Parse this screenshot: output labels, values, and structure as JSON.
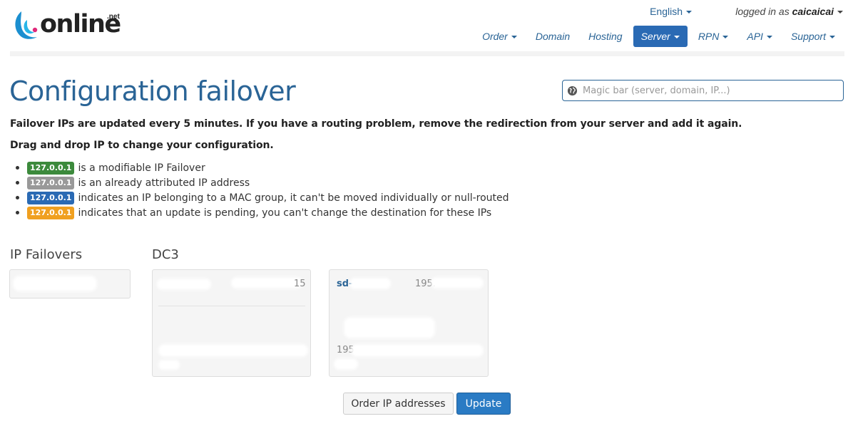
{
  "header": {
    "logo_text": "online",
    "logo_suffix": ".net",
    "language": "English",
    "logged_prefix": "logged in as",
    "username": "caicaicai",
    "nav": [
      {
        "label": "Order",
        "dropdown": true,
        "active": false
      },
      {
        "label": "Domain",
        "dropdown": false,
        "active": false
      },
      {
        "label": "Hosting",
        "dropdown": false,
        "active": false
      },
      {
        "label": "Server",
        "dropdown": true,
        "active": true
      },
      {
        "label": "RPN",
        "dropdown": true,
        "active": false
      },
      {
        "label": "API",
        "dropdown": true,
        "active": false
      },
      {
        "label": "Support",
        "dropdown": true,
        "active": false
      }
    ]
  },
  "page": {
    "title": "Configuration failover",
    "search_placeholder": "Magic bar (server, domain, IP...)",
    "notice": "Failover IPs are updated every 5 minutes. If you have a routing problem, remove the redirection from your server and add it again.",
    "instruction": "Drag and drop IP to change your configuration."
  },
  "legend": [
    {
      "badge": "127.0.0.1",
      "color": "#3c8a3c",
      "text": "is a modifiable IP Failover"
    },
    {
      "badge": "127.0.0.1",
      "color": "#999999",
      "text": "is an already attributed IP address"
    },
    {
      "badge": "127.0.0.1",
      "color": "#2a6ab4",
      "text": "indicates an IP belonging to a MAC group, it can't be moved individually or null-routed"
    },
    {
      "badge": "127.0.0.1",
      "color": "#f0a020",
      "text": "indicates that an update is pending, you can't change the destination for these IPs"
    }
  ],
  "sections": {
    "failovers_title": "IP Failovers",
    "dc_title": "DC3",
    "server_name_prefix": "sd-",
    "server_ip_prefix": "195.",
    "server_ip_prefix2": "195",
    "server1_fragment": "15"
  },
  "buttons": {
    "order_ip": "Order IP addresses",
    "update": "Update"
  },
  "colors": {
    "brand_blue": "#2a6496",
    "active_nav": "#2a6ab4",
    "primary_button": "#2a7bc4"
  }
}
